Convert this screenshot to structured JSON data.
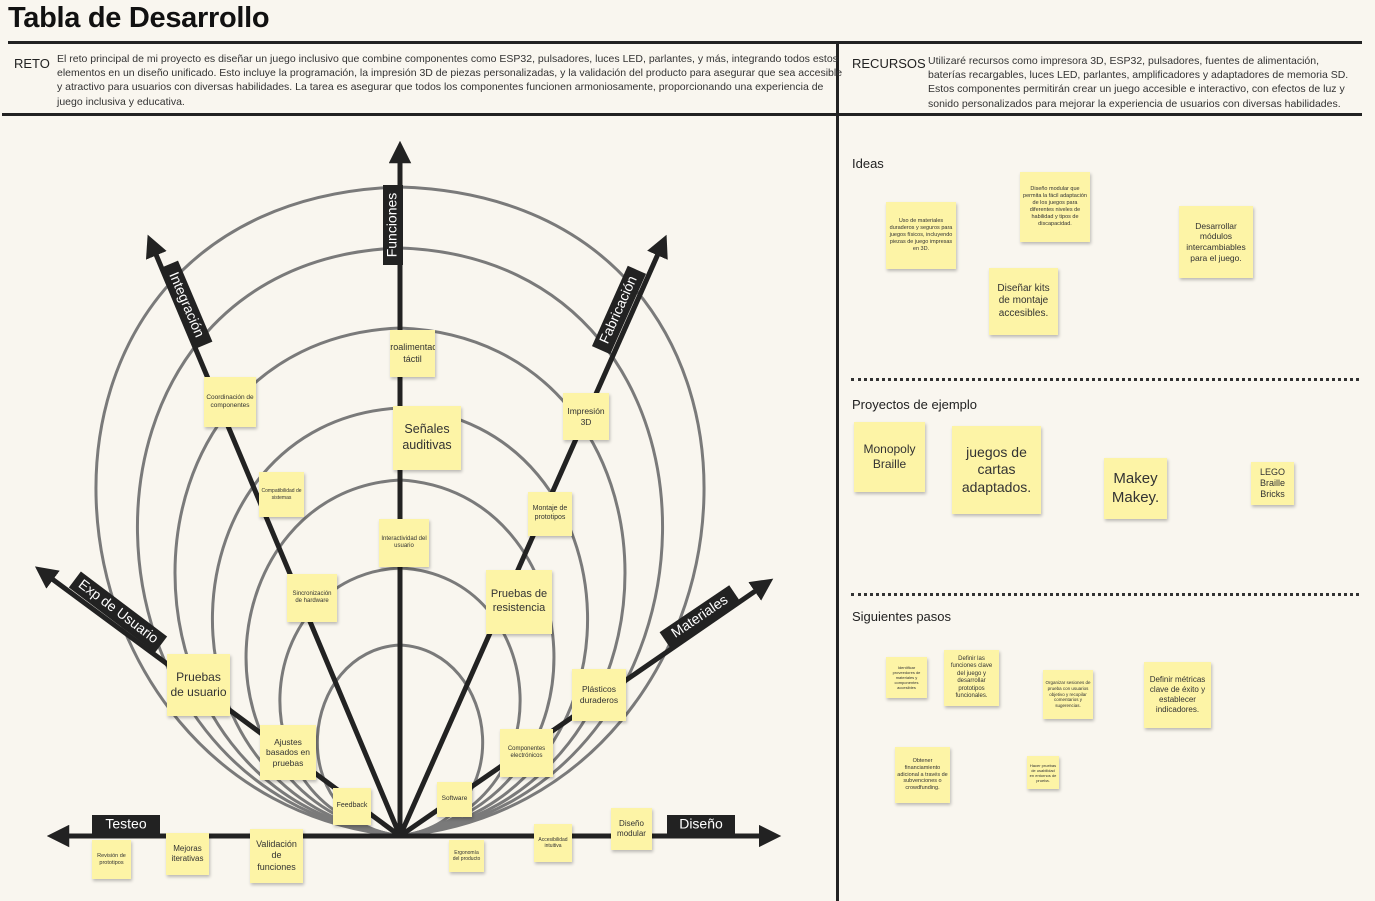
{
  "title": "Tabla de Desarrollo",
  "header": {
    "reto_label": "RETO",
    "reto_text": "El reto principal de mi proyecto es diseñar un juego inclusivo que combine componentes como ESP32, pulsadores, luces LED, parlantes, y más, integrando todos estos elementos en un diseño unificado. Esto incluye la programación, la impresión 3D de piezas personalizadas, y la validación del producto para asegurar que sea accesible y atractivo para usuarios con diversas habilidades. La tarea es asegurar que todos los componentes funcionen armoniosamente, proporcionando una experiencia de juego inclusiva y educativa.",
    "recursos_label": "RECURSOS",
    "recursos_text": "Utilizaré recursos como impresora 3D, ESP32, pulsadores, fuentes de alimentación, baterías recargables, luces LED, parlantes, amplificadores y adaptadores de memoria SD. Estos componentes permitirán crear un juego accesible e interactivo, con efectos de luz y sonido personalizados para mejorar la experiencia de usuarios con diversas habilidades."
  },
  "diagram": {
    "axes": {
      "funciones": "Funciones",
      "integracion": "Integración",
      "fabricacion": "Fabricación",
      "exp_usuario": "Exp de Usuario",
      "materiales": "Materiales",
      "testeo": "Testeo",
      "diseno": "Diseño"
    },
    "notes": [
      "Retroalimentación táctil",
      "Señales auditivas",
      "Interactividad del usuario",
      "Coordinación de componentes",
      "Compatibilidad de sistemas",
      "Sincronización de hardware",
      "Impresión 3D",
      "Montaje de prototipos",
      "Pruebas de resistencia",
      "Pruebas de usuario",
      "Ajustes basados en pruebas",
      "Feedback",
      "Plásticos duraderos",
      "Componentes electrónicos",
      "Software",
      "Diseño modular",
      "Accesibilidad intuitiva",
      "Ergonomía del producto",
      "Validación de funciones",
      "Mejoras iterativas",
      "Revisión de prototipos"
    ]
  },
  "sections": {
    "ideas": {
      "title": "Ideas",
      "notes": [
        "Uso de materiales duraderos y seguros para juegos físicos, incluyendo piezas de juego impresas en 3D.",
        "Diseño modular que permita la fácil adaptación de los juegos para diferentes niveles de habilidad y tipos de discapacidad.",
        "Desarrollar módulos intercambiables para el juego.",
        "Diseñar kits de montaje accesibles."
      ]
    },
    "proyectos": {
      "title": "Proyectos de ejemplo",
      "notes": [
        "Monopoly Braille",
        "juegos de cartas adaptados.",
        "Makey Makey.",
        "LEGO Braille Bricks"
      ]
    },
    "pasos": {
      "title": "Siguientes pasos",
      "notes": [
        "Identificar proveedores de materiales y componentes accesibles",
        "Definir las funciones clave del juego y desarrollar prototipos funcionales.",
        "Organizar sesiones de prueba con usuarios objetivo y recopilar comentarios y sugerencias.",
        "Definir métricas clave de éxito y establecer indicadores.",
        "Obtener financiamiento adicional a través de subvenciones o crowdfunding.",
        "Hacer pruebas de usabilidad en entornos de prueba."
      ]
    }
  },
  "colors": {
    "background": "#f9f6ef",
    "note": "#fdf4a6",
    "axis": "#222222",
    "ring": "#7a7a7a"
  }
}
